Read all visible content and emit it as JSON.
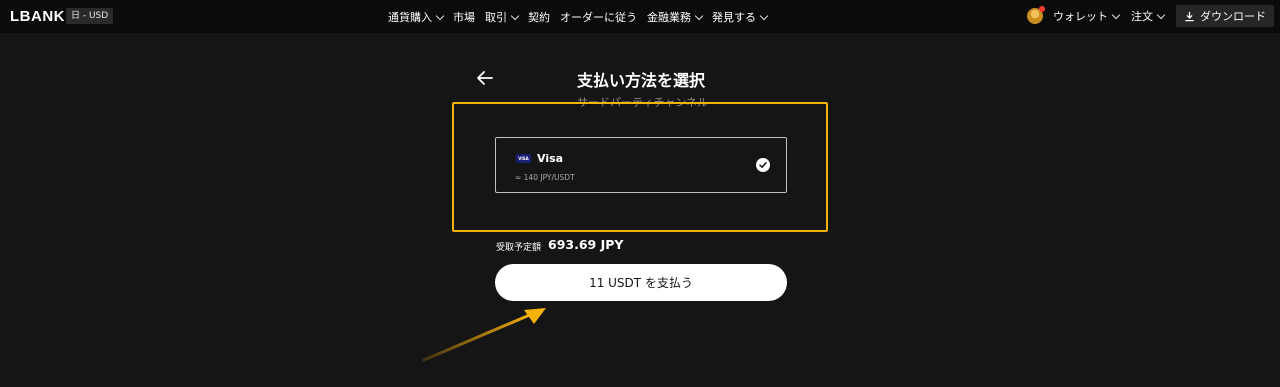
{
  "header": {
    "logo": "LBANK",
    "lang_currency": "日 - USD",
    "nav": [
      {
        "label": "通貨購入",
        "dropdown": true
      },
      {
        "label": "市場",
        "dropdown": false
      },
      {
        "label": "取引",
        "dropdown": true
      },
      {
        "label": "契約",
        "dropdown": false
      },
      {
        "label": "オーダーに従う",
        "dropdown": false
      },
      {
        "label": "金融業務",
        "dropdown": true
      },
      {
        "label": "発見する",
        "dropdown": true
      }
    ],
    "wallet_label": "ウォレット",
    "orders_label": "注文",
    "download_label": "ダウンロード"
  },
  "main": {
    "title": "支払い方法を選択",
    "subtitle": "サードパーティチャンネル",
    "payment_method": {
      "icon": "visa-card-icon",
      "icon_text": "VISA",
      "name": "Visa",
      "rate": "≈ 140 JPY/USDT",
      "selected": true
    },
    "receive_label": "受取予定額",
    "receive_value": "693.69 JPY",
    "pay_button_label": "11 USDT を支払う"
  },
  "colors": {
    "background": "#151515",
    "topbar": "#0b0b0b",
    "highlight": "#f6b10a",
    "button": "#ffffff"
  }
}
